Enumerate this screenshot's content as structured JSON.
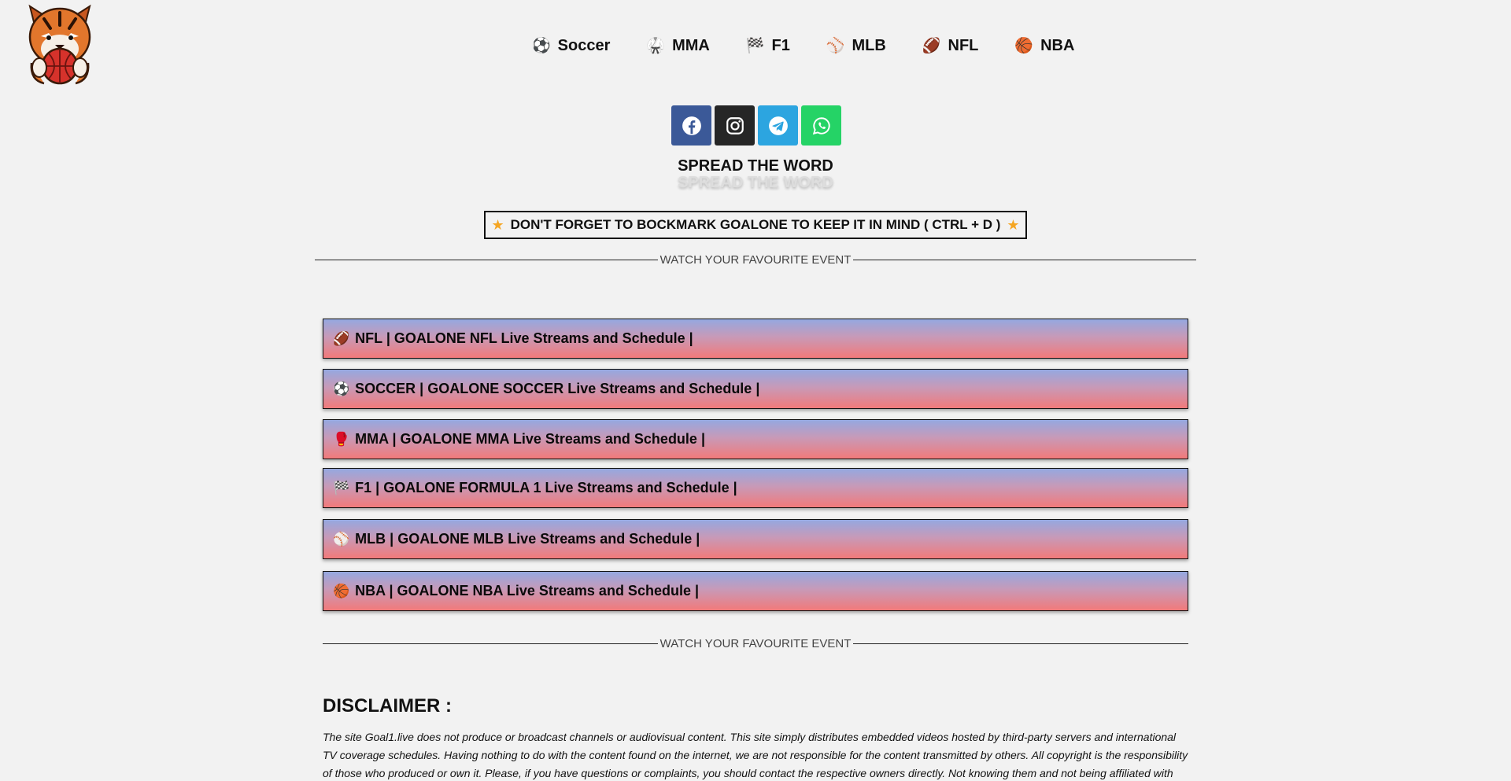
{
  "nav": {
    "items": [
      {
        "label": "Soccer",
        "icon": "⚽"
      },
      {
        "label": "MMA",
        "icon": "🥋"
      },
      {
        "label": "F1",
        "icon": "🏁"
      },
      {
        "label": "MLB",
        "icon": "⚾"
      },
      {
        "label": "NFL",
        "icon": "🏈"
      },
      {
        "label": "NBA",
        "icon": "🏀"
      }
    ]
  },
  "social": {
    "colors": {
      "facebook": "#3b5998",
      "instagram": "#262626",
      "telegram": "#2ca5e0",
      "whatsapp": "#25d366"
    }
  },
  "spread_title": "SPREAD THE WORD",
  "spread_subtitle": "SPREAD THE WORD",
  "bookmark": "DON'T FORGET TO BOCKMARK GOALONE TO KEEP IT IN MIND ( CTRL + D )",
  "divider_text": "WATCH YOUR FAVOURITE EVENT",
  "events": [
    {
      "icon": "🏈",
      "label": "NFL | GOALONE NFL Live Streams and Schedule |"
    },
    {
      "icon": "⚽",
      "label": "SOCCER | GOALONE SOCCER Live Streams and Schedule |"
    },
    {
      "icon": "🥊",
      "label": "MMA | GOALONE MMA Live Streams and Schedule |"
    },
    {
      "icon": "🏁",
      "label": "F1 | GOALONE FORMULA 1 Live Streams and Schedule |"
    },
    {
      "icon": "⚾",
      "label": "MLB | GOALONE MLB Live Streams and Schedule |"
    },
    {
      "icon": "🏀",
      "label": "NBA | GOALONE NBA Live Streams and Schedule |"
    }
  ],
  "disclaimer": {
    "title": "DISCLAIMER :",
    "text": "The site Goal1.live does not produce or broadcast channels or audiovisual content. This site simply distributes embedded videos hosted by third-party servers and international TV coverage schedules. Having nothing to do with the content found on the internet, we are not responsible for the content transmitted by others. All copyright is the responsibility of those who produced or own it. Please, if you have questions or complaints, you should contact the respective owners directly. Not knowing them and not being affiliated with"
  }
}
